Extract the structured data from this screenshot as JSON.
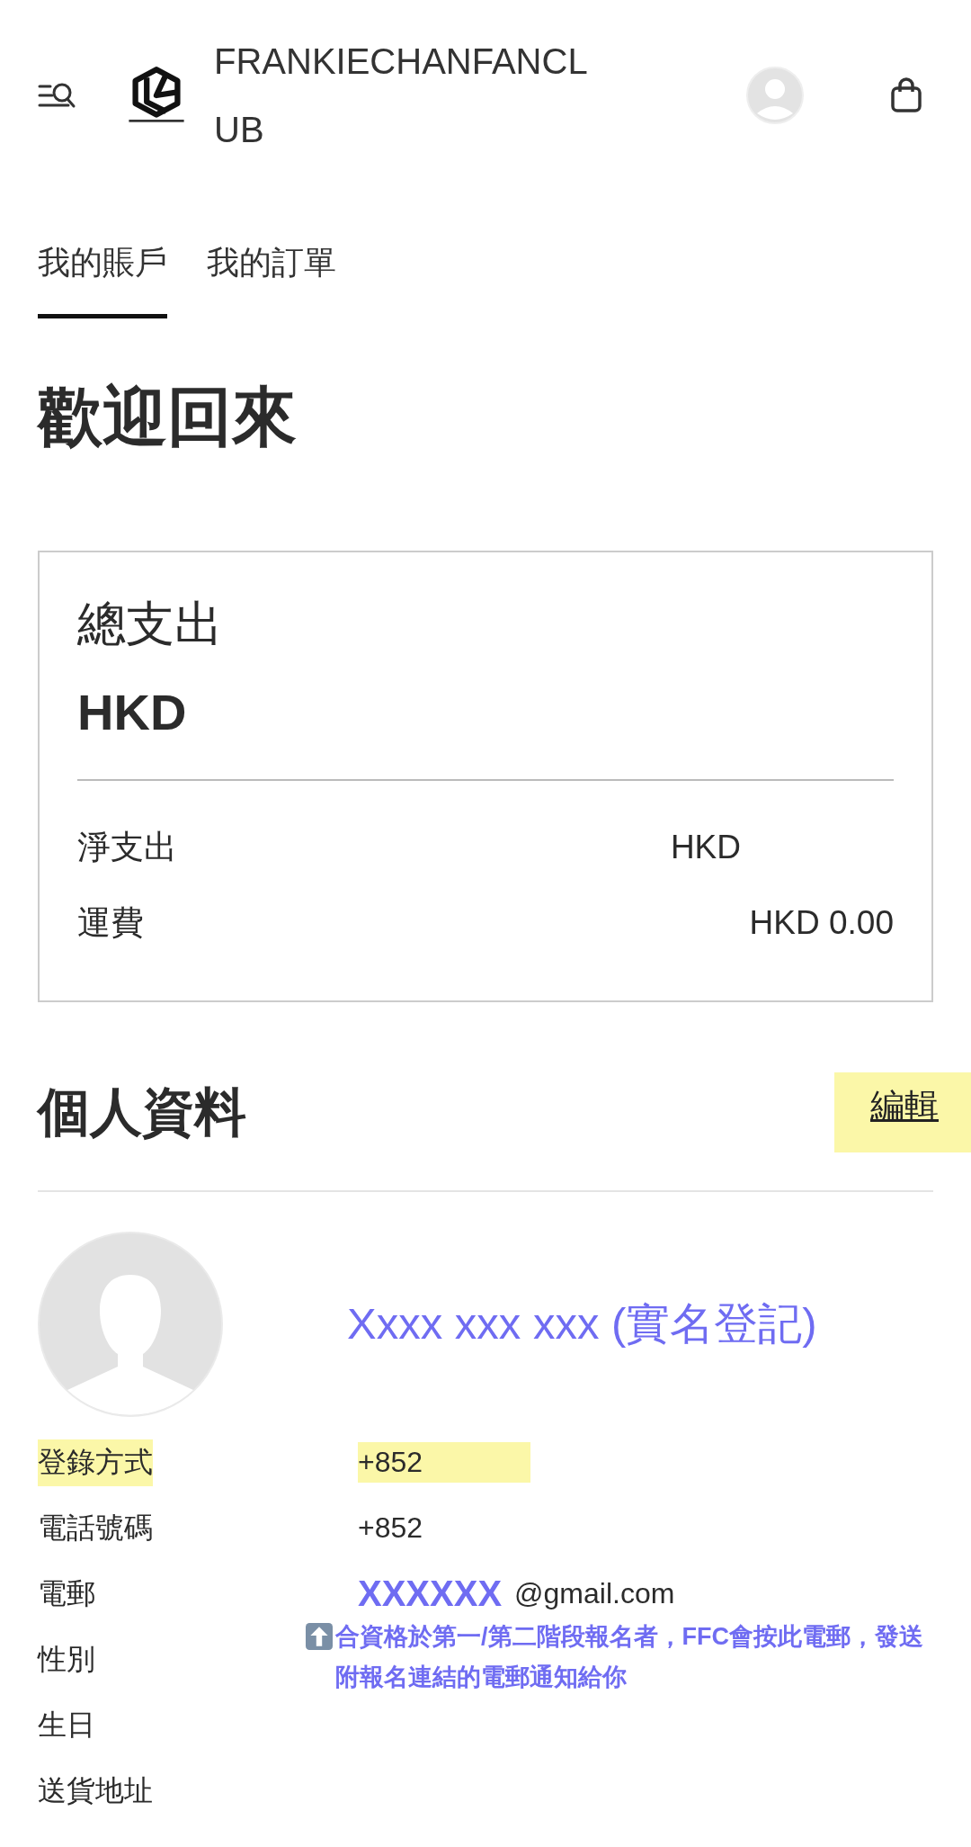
{
  "header": {
    "brand": "FRANKIECHANFANCLUB"
  },
  "tabs": [
    {
      "label": "我的賬戶",
      "selected": true
    },
    {
      "label": "我的訂單",
      "selected": false
    }
  ],
  "welcome": "歡迎回來",
  "spending": {
    "title": "總支出",
    "total": "HKD",
    "rows": [
      {
        "label": "淨支出",
        "value": "HKD"
      },
      {
        "label": "運費",
        "value": "HKD 0.00"
      }
    ]
  },
  "profile": {
    "title": "個人資料",
    "edit_link": {
      "label": "編輯",
      "highlighted": true
    },
    "name": "Xxxx xxx xxx (實名登記)",
    "rows": [
      {
        "label": "登錄方式",
        "value": "+852",
        "highlighted": true
      },
      {
        "label": "電話號碼",
        "value": "+852",
        "highlighted": false
      },
      {
        "label": "電郵",
        "value": "@gmail.com",
        "redacted": "XXXXXX",
        "highlighted": false,
        "note": "合資格於第一/第二階段報名者，FFC會按此電郵，發送附報名連結的電郵通知給你"
      },
      {
        "label": "性別",
        "highlighted": false
      },
      {
        "label": "生日",
        "highlighted": false
      },
      {
        "label": "送貨地址",
        "highlighted": false
      }
    ]
  }
}
